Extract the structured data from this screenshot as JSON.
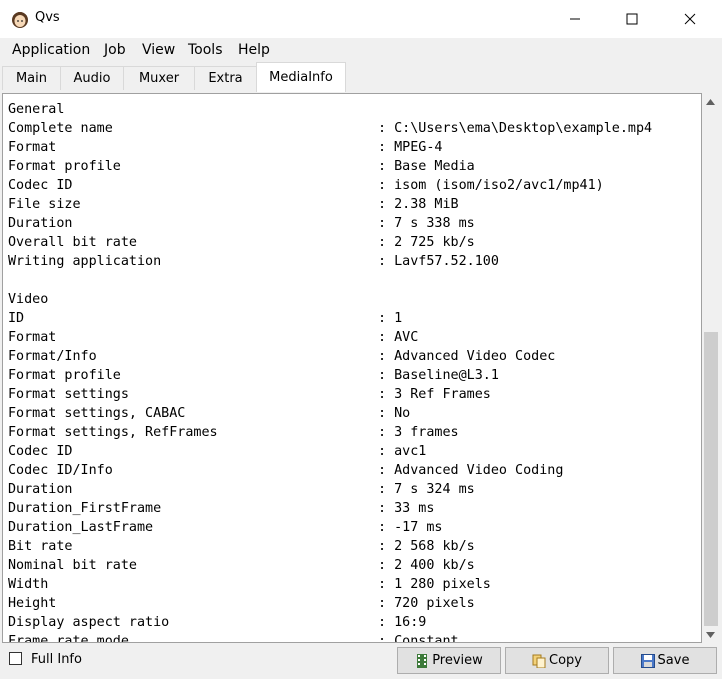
{
  "window": {
    "title": "Qvs"
  },
  "menu": [
    "Application",
    "Job",
    "View",
    "Tools",
    "Help"
  ],
  "tabs": [
    "Main",
    "Audio",
    "Muxer",
    "Extra",
    "MediaInfo"
  ],
  "active_tab": "MediaInfo",
  "mediainfo": [
    {
      "k": "General",
      "v": ""
    },
    {
      "k": "Complete name",
      "v": "C:\\Users\\ema\\Desktop\\example.mp4"
    },
    {
      "k": "Format",
      "v": "MPEG-4"
    },
    {
      "k": "Format profile",
      "v": "Base Media"
    },
    {
      "k": "Codec ID",
      "v": "isom (isom/iso2/avc1/mp41)"
    },
    {
      "k": "File size",
      "v": "2.38 MiB"
    },
    {
      "k": "Duration",
      "v": "7 s 338 ms"
    },
    {
      "k": "Overall bit rate",
      "v": "2 725 kb/s"
    },
    {
      "k": "Writing application",
      "v": "Lavf57.52.100"
    },
    {
      "k": "",
      "v": ""
    },
    {
      "k": "Video",
      "v": ""
    },
    {
      "k": "ID",
      "v": "1"
    },
    {
      "k": "Format",
      "v": "AVC"
    },
    {
      "k": "Format/Info",
      "v": "Advanced Video Codec"
    },
    {
      "k": "Format profile",
      "v": "Baseline@L3.1"
    },
    {
      "k": "Format settings",
      "v": "3 Ref Frames"
    },
    {
      "k": "Format settings, CABAC",
      "v": "No"
    },
    {
      "k": "Format settings, RefFrames",
      "v": "3 frames"
    },
    {
      "k": "Codec ID",
      "v": "avc1"
    },
    {
      "k": "Codec ID/Info",
      "v": "Advanced Video Coding"
    },
    {
      "k": "Duration",
      "v": "7 s 324 ms"
    },
    {
      "k": "Duration_FirstFrame",
      "v": "33 ms"
    },
    {
      "k": "Duration_LastFrame",
      "v": "-17 ms"
    },
    {
      "k": "Bit rate",
      "v": "2 568 kb/s"
    },
    {
      "k": "Nominal bit rate",
      "v": "2 400 kb/s"
    },
    {
      "k": "Width",
      "v": "1 280 pixels"
    },
    {
      "k": "Height",
      "v": "720 pixels"
    },
    {
      "k": "Display aspect ratio",
      "v": "16:9"
    },
    {
      "k": "Frame rate mode",
      "v": "Constant"
    }
  ],
  "full_info": {
    "label": "Full Info",
    "checked": false
  },
  "buttons": {
    "preview": "Preview",
    "copy": "Copy",
    "save": "Save"
  },
  "icons": {
    "app": "girl-face-icon",
    "preview": "film-icon",
    "copy": "copy-icon",
    "save": "floppy-disk-icon"
  }
}
